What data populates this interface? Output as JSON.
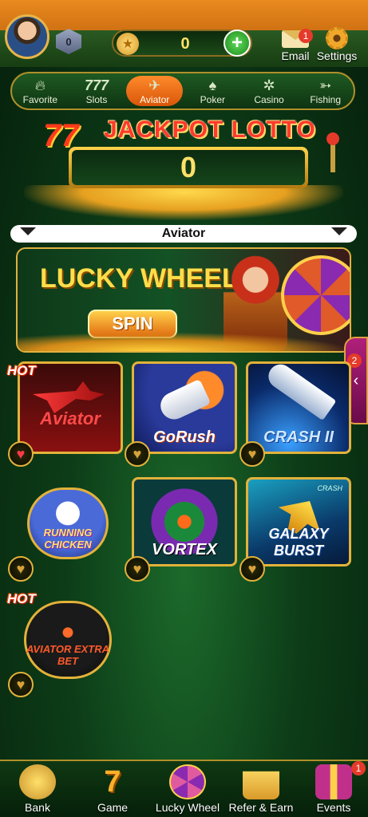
{
  "header": {
    "coins": "0",
    "email_label": "Email",
    "email_badge": "1",
    "settings_label": "Settings",
    "vip_label": "0"
  },
  "tabs": [
    {
      "label": "Favorite",
      "icon": "flame-icon"
    },
    {
      "label": "Slots",
      "icon": "seven-icon"
    },
    {
      "label": "Aviator",
      "icon": "plane-icon",
      "active": true
    },
    {
      "label": "Poker",
      "icon": "cards-icon"
    },
    {
      "label": "Casino",
      "icon": "chip-icon"
    },
    {
      "label": "Fishing",
      "icon": "fish-icon"
    }
  ],
  "jackpot": {
    "title": "JACKPOT LOTTO",
    "sevens": "77",
    "value": "0"
  },
  "section": {
    "selected": "Aviator"
  },
  "banner": {
    "title": "LUCKY WHEEL",
    "button": "SPIN"
  },
  "side_tab": {
    "badge": "2"
  },
  "games": [
    {
      "name": "Aviator",
      "hot": "HOT",
      "favorited": true
    },
    {
      "name": "GoRush",
      "favorited": false
    },
    {
      "name": "CRASH II",
      "favorited": false
    },
    {
      "name": "RUNNING CHICKEN",
      "favorited": false
    },
    {
      "name": "VORTEX",
      "favorited": false
    },
    {
      "name": "GALAXY BURST",
      "tag": "CRASH",
      "favorited": false
    },
    {
      "name": "AVIATOR EXTRA BET",
      "hot": "HOT",
      "favorited": false
    }
  ],
  "bottom_nav": [
    {
      "label": "Bank"
    },
    {
      "label": "Game"
    },
    {
      "label": "Lucky Wheel"
    },
    {
      "label": "Refer & Earn"
    },
    {
      "label": "Events",
      "badge": "1"
    }
  ],
  "colors": {
    "gold": "#e2b23a",
    "header_orange": "#e88a1e",
    "active_tab": "#ff8a2a",
    "jackpot_red": "#ff3a2a"
  }
}
